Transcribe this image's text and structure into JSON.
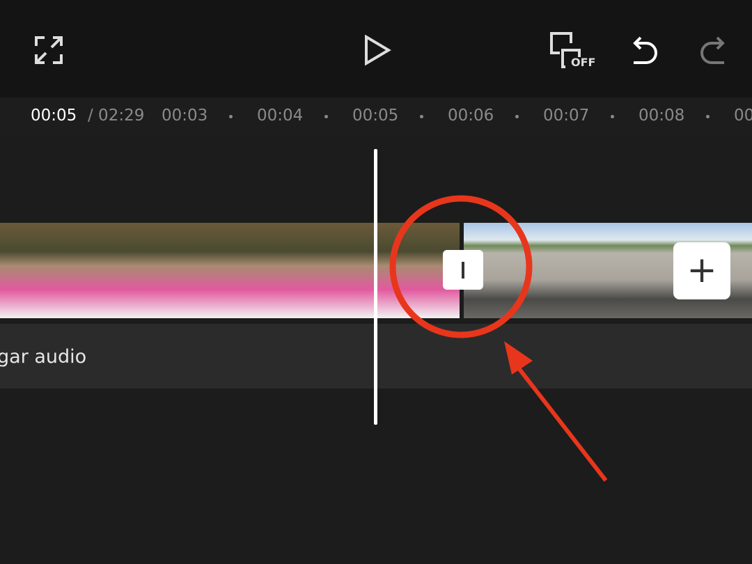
{
  "toolbar": {
    "fullscreen_icon": "fullscreen-icon",
    "play_icon": "play-icon",
    "caption_toggle_label": "OFF",
    "undo_icon": "undo-icon",
    "redo_icon": "redo-icon"
  },
  "timeline": {
    "current_time": "00:05",
    "total_time": "/ 02:29",
    "ticks": [
      "00:03",
      "00:04",
      "00:05",
      "00:06",
      "00:07",
      "00:08",
      "00:0"
    ]
  },
  "tracks": {
    "audio_label": "gar audio",
    "transition_icon": "transition-icon",
    "add_clip_icon": "plus-icon",
    "add_label": "+"
  },
  "annotation": {
    "color": "#e8361c"
  }
}
